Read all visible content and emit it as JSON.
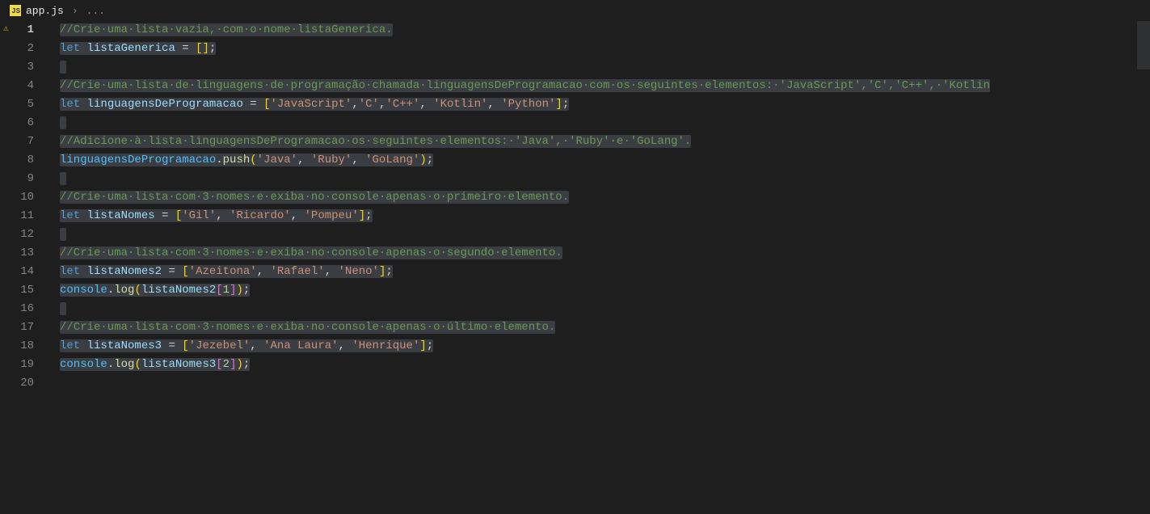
{
  "tab": {
    "filename": "app.js",
    "breadcrumb_more": "..."
  },
  "lines": {
    "l1": "//Crie·uma·lista·vazia,·com·o·nome·listaGenerica.",
    "l2_let": "let",
    "l2_var": "listaGenerica",
    "l2_rest": " = []",
    "l4": "//Crie·uma·lista·de·linguagens·de·programação·chamada·linguagensDeProgramacao·com·os·seguintes·elementos:·'JavaScript','C','C++',·'Kotlin",
    "l5_let": "let",
    "l5_var": "linguagensDeProgramacao",
    "l5_s1": "'JavaScript'",
    "l5_s2": "'C'",
    "l5_s3": "'C++'",
    "l5_s4": "'Kotlin'",
    "l5_s5": "'Python'",
    "l7": "//Adicione·à·lista·linguagensDeProgramacao·os·seguintes·elementos:·'Java',·'Ruby'·e·'GoLang'.",
    "l8_var": "linguagensDeProgramacao",
    "l8_func": "push",
    "l8_s1": "'Java'",
    "l8_s2": "'Ruby'",
    "l8_s3": "'GoLang'",
    "l10": "//Crie·uma·lista·com·3·nomes·e·exiba·no·console·apenas·o·primeiro·elemento.",
    "l11_let": "let",
    "l11_var": "listaNomes",
    "l11_s1": "'Gil'",
    "l11_s2": "'Ricardo'",
    "l11_s3": "'Pompeu'",
    "l13": "//Crie·uma·lista·com·3·nomes·e·exiba·no·console·apenas·o·segundo·elemento.",
    "l14_let": "let",
    "l14_var": "listaNomes2",
    "l14_s1": "'Azeitona'",
    "l14_s2": "'Rafael'",
    "l14_s3": "'Neno'",
    "l15_obj": "console",
    "l15_func": "log",
    "l15_var": "listaNomes2",
    "l15_idx": "1",
    "l17": "//Crie·uma·lista·com·3·nomes·e·exiba·no·console·apenas·o·último·elemento.",
    "l18_let": "let",
    "l18_var": "listaNomes3",
    "l18_s1": "'Jezebel'",
    "l18_s2": "'Ana Laura'",
    "l18_s3": "'Henrique'",
    "l19_obj": "console",
    "l19_func": "log",
    "l19_var": "listaNomes3",
    "l19_idx": "2"
  },
  "gutter": [
    "1",
    "2",
    "3",
    "4",
    "5",
    "6",
    "7",
    "8",
    "9",
    "10",
    "11",
    "12",
    "13",
    "14",
    "15",
    "16",
    "17",
    "18",
    "19",
    "20"
  ]
}
